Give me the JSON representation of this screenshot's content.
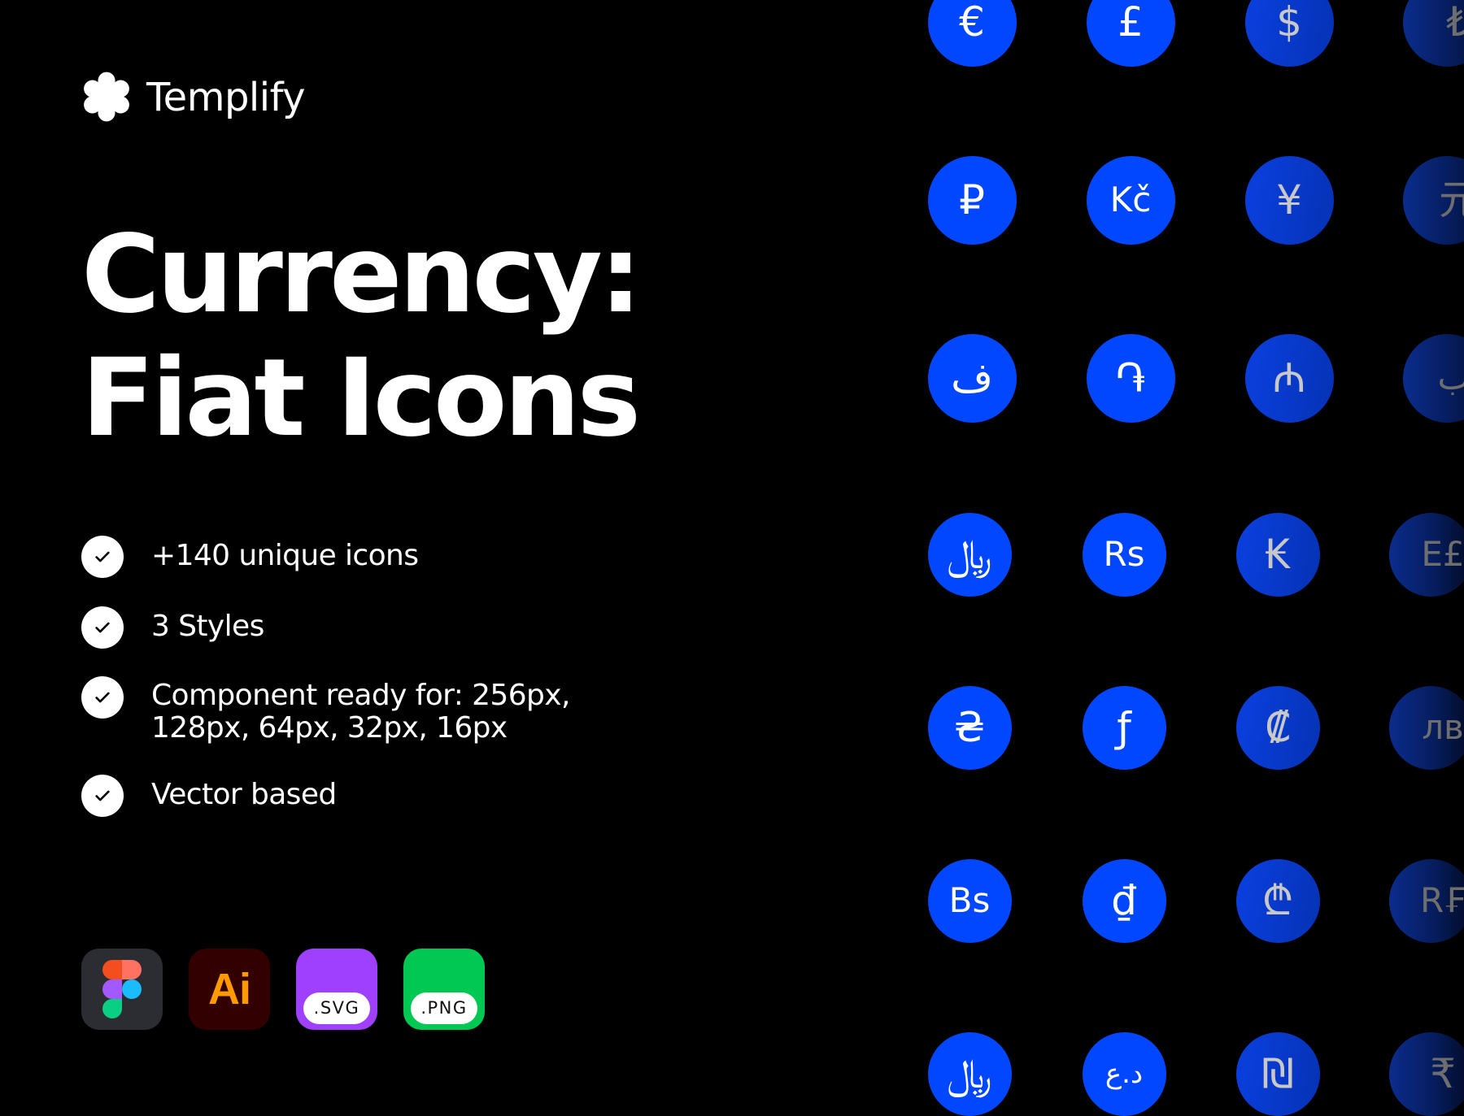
{
  "brand": {
    "name": "Templify",
    "logo_icon": "flower-logo-icon"
  },
  "title": {
    "line1": "Currency:",
    "line2": "Fiat Icons"
  },
  "features": [
    {
      "icon": "check-icon",
      "lines": [
        "+140 unique icons"
      ]
    },
    {
      "icon": "check-icon",
      "lines": [
        "3 Styles"
      ]
    },
    {
      "icon": "check-icon",
      "lines": [
        "Component ready for: 256px,",
        "128px, 64px, 32px, 16px"
      ]
    },
    {
      "icon": "check-icon",
      "lines": [
        "Vector based"
      ]
    }
  ],
  "formats": [
    {
      "id": "figma",
      "icon": "figma-logo-icon",
      "label": ""
    },
    {
      "id": "ai",
      "icon": "illustrator-logo-icon",
      "label": "Ai"
    },
    {
      "id": "svg",
      "icon": "svg-file-icon",
      "label": ".SVG"
    },
    {
      "id": "png",
      "icon": "png-file-icon",
      "label": ".PNG"
    }
  ],
  "colors": {
    "background": "#000000",
    "coin_blue": "#0047ff",
    "ai_bg": "#330000",
    "ai_fg": "#ff9a00",
    "svg_bg": "#a040ff",
    "png_bg": "#00c853",
    "figma_bg": "#2c2c33"
  },
  "currency_grid": {
    "rows": [
      [
        "€",
        "£",
        "$",
        "₺"
      ],
      [
        "₽",
        "Kč",
        "¥",
        "元"
      ],
      [
        "ف",
        "֏",
        "₼",
        "ب."
      ],
      [
        "﷼",
        "Rs",
        "₭",
        "E£"
      ],
      [
        "₴",
        "ƒ",
        "₡",
        "лв"
      ],
      [
        "Bs",
        "₫",
        "₾",
        "R₣"
      ],
      [
        "﷼",
        "د.ع",
        "₪",
        "₹"
      ]
    ],
    "names": [
      [
        "euro",
        "pound",
        "dollar",
        "lira"
      ],
      [
        "ruble",
        "koruna",
        "yen",
        "yuan"
      ],
      [
        "afghani",
        "dram",
        "manat",
        "dinar"
      ],
      [
        "rial",
        "rupee",
        "kip",
        "egyptian-pound"
      ],
      [
        "hryvnia",
        "florin",
        "colon",
        "lev"
      ],
      [
        "bolivar",
        "dong",
        "lari",
        "rwandan-franc"
      ],
      [
        "riyal",
        "iraqi-dinar",
        "shekel",
        "indian-rupee"
      ]
    ]
  }
}
